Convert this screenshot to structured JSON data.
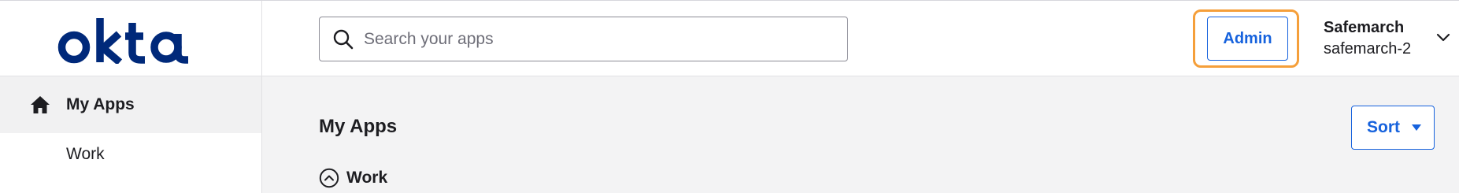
{
  "header": {
    "logo_text": "okta",
    "search": {
      "placeholder": "Search your apps",
      "value": ""
    },
    "admin_label": "Admin",
    "user": {
      "org_name": "Safemarch",
      "account": "safemarch-2"
    }
  },
  "sidebar": {
    "items": [
      {
        "label": "My Apps",
        "icon": "home-icon",
        "active": true
      },
      {
        "label": "Work",
        "active": false
      }
    ]
  },
  "main": {
    "title": "My Apps",
    "sort_label": "Sort",
    "sections": [
      {
        "label": "Work",
        "expanded": true
      }
    ]
  },
  "colors": {
    "brand_navy": "#00297a",
    "accent_blue": "#1662dd",
    "focus_orange": "#f59f3a",
    "main_background": "#f3f3f4"
  }
}
